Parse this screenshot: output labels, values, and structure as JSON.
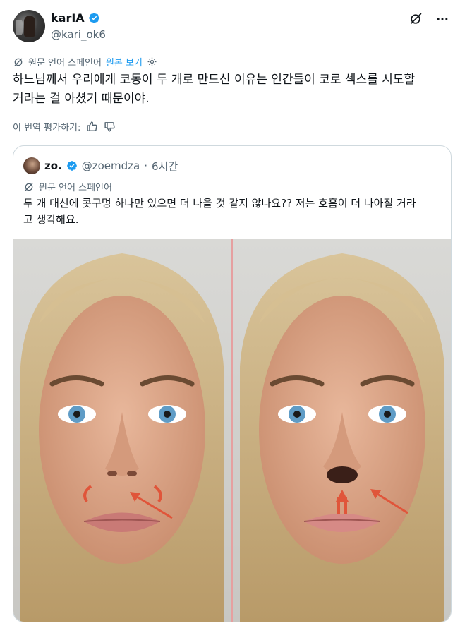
{
  "author": {
    "display_name": "karIA",
    "handle": "@kari_ok6"
  },
  "header_icons": [
    "grok-icon",
    "more-icon"
  ],
  "translation": {
    "label": "원문 언어 스페인어",
    "show_original": "원본 보기"
  },
  "post": {
    "text_line1": "하느님께서 우리에게 코동이 두 개로 만드신 이유는 인간들이 코로 섹스를 시도할",
    "text_line2": "거라는 걸 아셨기 때문이야."
  },
  "rate": {
    "label": "이 번역 평가하기:"
  },
  "quote": {
    "display_name": "zo.",
    "handle": "@zoemdza",
    "separator": "·",
    "time": "6시간",
    "translation_label": "원문 언어 스페인어",
    "text_line1": "두 개 대신에 콧구멍 하나만 있으면 더 나을 것 같지 않나요?? 저는 호흡이 더 나아질 거라",
    "text_line2": "고 생각해요."
  },
  "colors": {
    "accent": "#1d9bf0",
    "secondary_text": "#536471",
    "border": "#cfd9de",
    "arrow": "#e0553a"
  }
}
